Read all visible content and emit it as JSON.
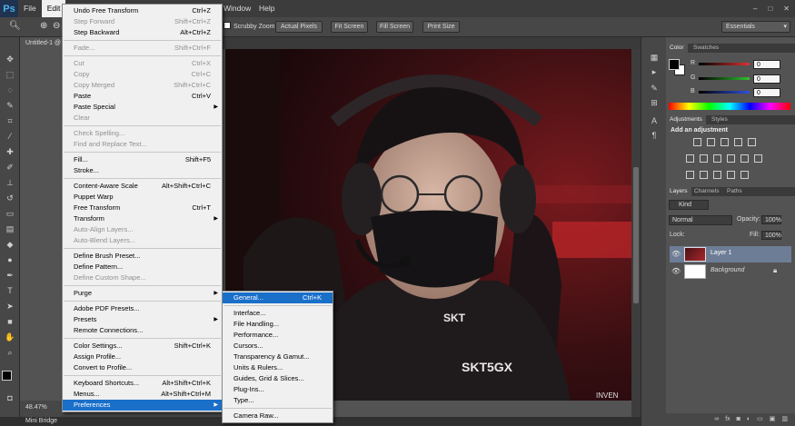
{
  "menubar": {
    "logo": "Ps",
    "items": [
      "File",
      "Edit"
    ],
    "window": "Window",
    "help": "Help",
    "window_controls": [
      "–",
      "□",
      "✕"
    ]
  },
  "options": {
    "scrubby_zoom": "Scrubby Zoom",
    "buttons": [
      "Actual Pixels",
      "Fit Screen",
      "Fill Screen",
      "Print Size"
    ],
    "workspace": "Essentials"
  },
  "document": {
    "tab_title": "Untitled-1 @",
    "zoom": "48.47%",
    "watermark": "INVEN"
  },
  "mini_bridge": "Mini Bridge",
  "edit_menu": [
    {
      "label": "Undo Free Transform",
      "shortcut": "Ctrl+Z"
    },
    {
      "label": "Step Forward",
      "shortcut": "Shift+Ctrl+Z",
      "disabled": true
    },
    {
      "label": "Step Backward",
      "shortcut": "Alt+Ctrl+Z"
    },
    {
      "sep": true
    },
    {
      "label": "Fade...",
      "shortcut": "Shift+Ctrl+F",
      "disabled": true
    },
    {
      "sep": true
    },
    {
      "label": "Cut",
      "shortcut": "Ctrl+X",
      "disabled": true
    },
    {
      "label": "Copy",
      "shortcut": "Ctrl+C",
      "disabled": true
    },
    {
      "label": "Copy Merged",
      "shortcut": "Shift+Ctrl+C",
      "disabled": true
    },
    {
      "label": "Paste",
      "shortcut": "Ctrl+V"
    },
    {
      "label": "Paste Special",
      "submenu": true
    },
    {
      "label": "Clear",
      "disabled": true
    },
    {
      "sep": true
    },
    {
      "label": "Check Spelling...",
      "disabled": true
    },
    {
      "label": "Find and Replace Text...",
      "disabled": true
    },
    {
      "sep": true
    },
    {
      "label": "Fill...",
      "shortcut": "Shift+F5"
    },
    {
      "label": "Stroke..."
    },
    {
      "sep": true
    },
    {
      "label": "Content-Aware Scale",
      "shortcut": "Alt+Shift+Ctrl+C"
    },
    {
      "label": "Puppet Warp"
    },
    {
      "label": "Free Transform",
      "shortcut": "Ctrl+T"
    },
    {
      "label": "Transform",
      "submenu": true
    },
    {
      "label": "Auto-Align Layers...",
      "disabled": true
    },
    {
      "label": "Auto-Blend Layers...",
      "disabled": true
    },
    {
      "sep": true
    },
    {
      "label": "Define Brush Preset..."
    },
    {
      "label": "Define Pattern..."
    },
    {
      "label": "Define Custom Shape...",
      "disabled": true
    },
    {
      "sep": true
    },
    {
      "label": "Purge",
      "submenu": true
    },
    {
      "sep": true
    },
    {
      "label": "Adobe PDF Presets..."
    },
    {
      "label": "Presets",
      "submenu": true
    },
    {
      "label": "Remote Connections..."
    },
    {
      "sep": true
    },
    {
      "label": "Color Settings...",
      "shortcut": "Shift+Ctrl+K"
    },
    {
      "label": "Assign Profile..."
    },
    {
      "label": "Convert to Profile..."
    },
    {
      "sep": true
    },
    {
      "label": "Keyboard Shortcuts...",
      "shortcut": "Alt+Shift+Ctrl+K"
    },
    {
      "label": "Menus...",
      "shortcut": "Alt+Shift+Ctrl+M"
    },
    {
      "label": "Preferences",
      "submenu": true,
      "highlight": true
    }
  ],
  "prefs_menu": [
    {
      "label": "General...",
      "shortcut": "Ctrl+K",
      "highlight": true
    },
    {
      "sep": true
    },
    {
      "label": "Interface..."
    },
    {
      "label": "File Handling..."
    },
    {
      "label": "Performance..."
    },
    {
      "label": "Cursors..."
    },
    {
      "label": "Transparency & Gamut..."
    },
    {
      "label": "Units & Rulers..."
    },
    {
      "label": "Guides, Grid & Slices..."
    },
    {
      "label": "Plug-Ins..."
    },
    {
      "label": "Type..."
    },
    {
      "sep": true
    },
    {
      "label": "Camera Raw..."
    }
  ],
  "color_panel": {
    "tabs": [
      "Color",
      "Swatches"
    ],
    "channels": [
      {
        "label": "R",
        "value": "0",
        "color": "#e03030"
      },
      {
        "label": "G",
        "value": "0",
        "color": "#30c030"
      },
      {
        "label": "B",
        "value": "0",
        "color": "#3050e0"
      }
    ]
  },
  "adjustments_panel": {
    "tabs": [
      "Adjustments",
      "Styles"
    ],
    "title": "Add an adjustment"
  },
  "layers_panel": {
    "tabs": [
      "Layers",
      "Channels",
      "Paths"
    ],
    "kind": "Kind",
    "blend_mode": "Normal",
    "opacity_label": "Opacity:",
    "opacity": "100%",
    "lock_label": "Lock:",
    "fill_label": "Fill:",
    "fill": "100%",
    "layers": [
      {
        "name": "Layer 1",
        "selected": true
      },
      {
        "name": "Background",
        "italic": true
      }
    ]
  },
  "colors": {
    "menu_highlight": "#1a6fc9",
    "panel_bg": "#535353",
    "chrome": "#474747"
  }
}
